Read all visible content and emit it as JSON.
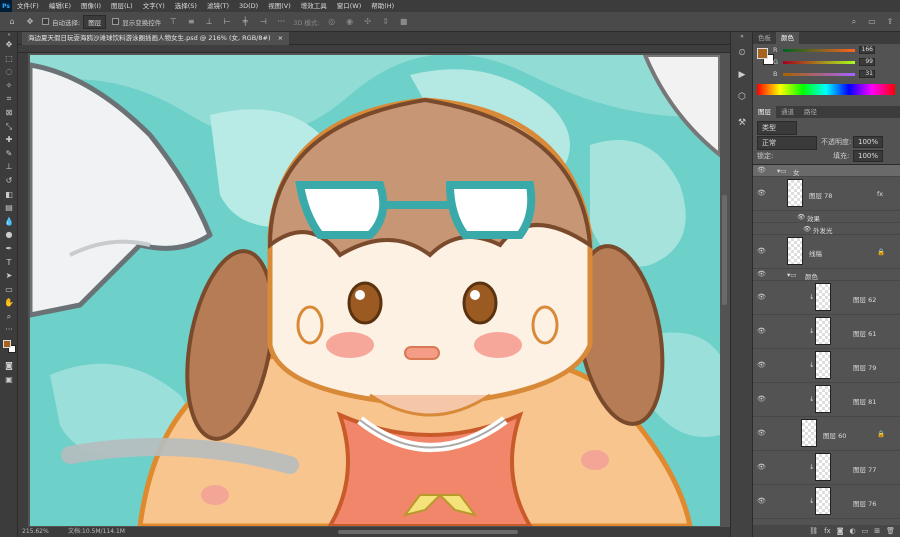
{
  "menu": {
    "app_logo": "Ps",
    "items": [
      "文件(F)",
      "编辑(E)",
      "图像(I)",
      "图层(L)",
      "文字(Y)",
      "选择(S)",
      "滤镜(T)",
      "3D(D)",
      "视图(V)",
      "增效工具",
      "窗口(W)",
      "帮助(H)"
    ]
  },
  "options": {
    "auto_select_label": "自动选择:",
    "auto_select_value": "图层",
    "show_transform_label": "显示变换控件",
    "mode_3d": "3D 模式:"
  },
  "document": {
    "tab_title": "海边夏天假日玩耍海鸥沙滩球饮料游泳圈插画人物女生.psd @ 216% (女, RGB/8#)",
    "zoom": "215.62%",
    "doc_size": "文档:10.5M/114.1M"
  },
  "color_panel": {
    "tabs": [
      "色板",
      "颜色"
    ],
    "active_tab": "颜色",
    "r_label": "R",
    "r_value": "166",
    "g_label": "G",
    "g_value": "99",
    "b_label": "B",
    "b_value": "31",
    "fg_color": "#a6631f",
    "bg_color": "#ffffff"
  },
  "layers_panel": {
    "tabs": [
      "图层",
      "通道",
      "路径"
    ],
    "active_tab": "图层",
    "kind_filter": "类型",
    "blend_mode": "正常",
    "opacity_label": "不透明度:",
    "opacity_value": "100%",
    "lock_label": "锁定:",
    "fill_label": "填充:",
    "fill_value": "100%",
    "rows": [
      {
        "name": "女",
        "type": "group"
      },
      {
        "name": "图层 78",
        "fx": "fx"
      },
      {
        "name": "效果",
        "type": "effect"
      },
      {
        "name": "外发光",
        "type": "effect"
      },
      {
        "name": "线稿",
        "locked": true
      },
      {
        "name": "颜色",
        "type": "group"
      },
      {
        "name": "图层 62"
      },
      {
        "name": "图层 61"
      },
      {
        "name": "图层 79"
      },
      {
        "name": "图层 81"
      },
      {
        "name": "图层 60",
        "locked": true
      },
      {
        "name": "图层 77"
      },
      {
        "name": "图层 76"
      }
    ]
  }
}
